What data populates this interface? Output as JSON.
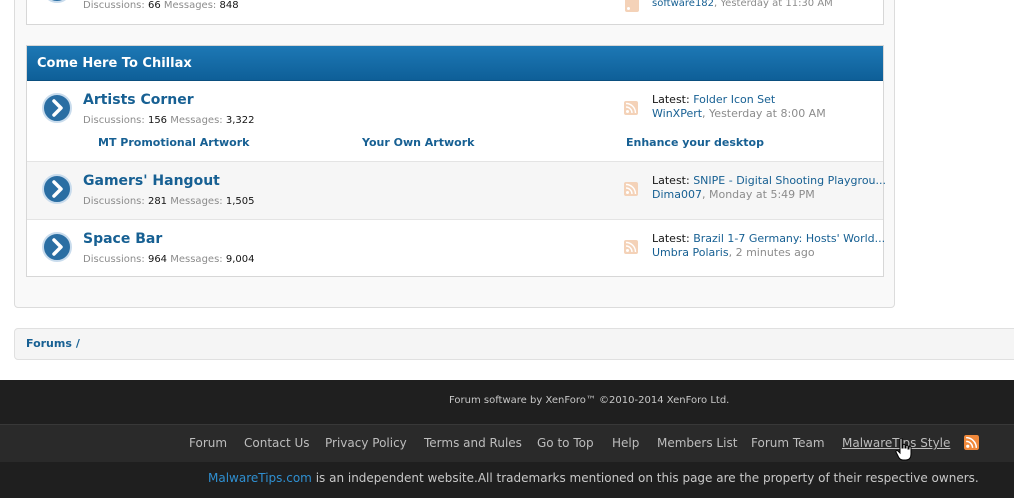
{
  "top_node": {
    "discussions_label": "Discussions:",
    "discussions": "66",
    "messages_label": "Messages:",
    "messages": "848",
    "last_user": "software182",
    "last_time": ", Yesterday at 11:30 AM"
  },
  "category": {
    "title": "Come Here To Chillax",
    "nodes": [
      {
        "title": "Artists Corner",
        "discussions_label": "Discussions:",
        "discussions": "156",
        "messages_label": "Messages:",
        "messages": "3,322",
        "latest_label": "Latest:",
        "latest_thread": "Folder Icon Set",
        "last_user": "WinXPert",
        "last_time": ", Yesterday at 8:00 AM",
        "subforums": [
          "MT Promotional Artwork",
          "Your Own Artwork",
          "Enhance your desktop"
        ]
      },
      {
        "title": "Gamers' Hangout",
        "discussions_label": "Discussions:",
        "discussions": "281",
        "messages_label": "Messages:",
        "messages": "1,505",
        "latest_label": "Latest:",
        "latest_thread": "SNIPE - Digital Shooting Playgrou...",
        "last_user": "Dima007",
        "last_time": ", Monday at 5:49 PM"
      },
      {
        "title": "Space Bar",
        "discussions_label": "Discussions:",
        "discussions": "964",
        "messages_label": "Messages:",
        "messages": "9,004",
        "latest_label": "Latest:",
        "latest_thread": "Brazil 1-7 Germany: Hosts' World...",
        "last_user": "Umbra Polaris",
        "last_time": ", 2 minutes ago"
      }
    ]
  },
  "breadcrumb": {
    "item": "Forums",
    "separator": "/"
  },
  "footer": {
    "copyright": "Forum software by XenForo™ ©2010-2014 XenForo Ltd.",
    "links": [
      "Forum",
      "Contact Us",
      "Privacy Policy",
      "Terms and Rules",
      "Go to Top",
      "Help",
      "Members List",
      "Forum Team",
      "MalwareTips Style"
    ],
    "site_name": "MalwareTips.com",
    "disclaimer": " is an independent website.All trademarks mentioned on this page are the property of their respective owners."
  },
  "colors": {
    "header_blue": "#176093",
    "footer_dark": "#1f1f1f",
    "rss_orange": "#f0883a"
  }
}
